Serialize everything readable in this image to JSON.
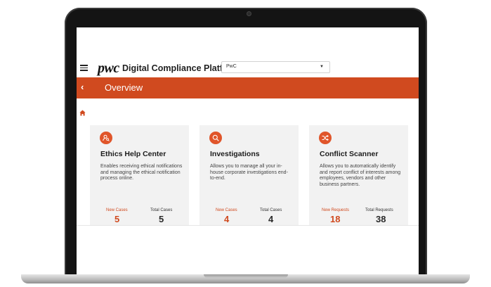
{
  "header": {
    "logo": "pwc",
    "app_title": "Digital Compliance Platform",
    "org_select": {
      "value": "PwC"
    }
  },
  "nav": {
    "back_glyph": "‹",
    "page_title": "Overview"
  },
  "colors": {
    "accent": "#d04a1f",
    "icon_circle": "#e0552a",
    "card_bg": "#f2f2f2"
  },
  "cards": [
    {
      "icon": "person-search-icon",
      "title": "Ethics Help Center",
      "description": "Enables receiving ethical notifications and managing the ethical notification process online.",
      "new_label": "New Cases",
      "new_value": "5",
      "total_label": "Total Cases",
      "total_value": "5"
    },
    {
      "icon": "magnifier-icon",
      "title": "Investigations",
      "description": "Allows you to manage all your in-house corporate investigations end-to-end.",
      "new_label": "New Cases",
      "new_value": "4",
      "total_label": "Total Cases",
      "total_value": "4"
    },
    {
      "icon": "shuffle-icon",
      "title": "Conflict Scanner",
      "description": "Allows you to automatically identify and report conflict of interests among employees, vendors and other business partners.",
      "new_label": "New Requests",
      "new_value": "18",
      "total_label": "Total Requests",
      "total_value": "38"
    }
  ]
}
